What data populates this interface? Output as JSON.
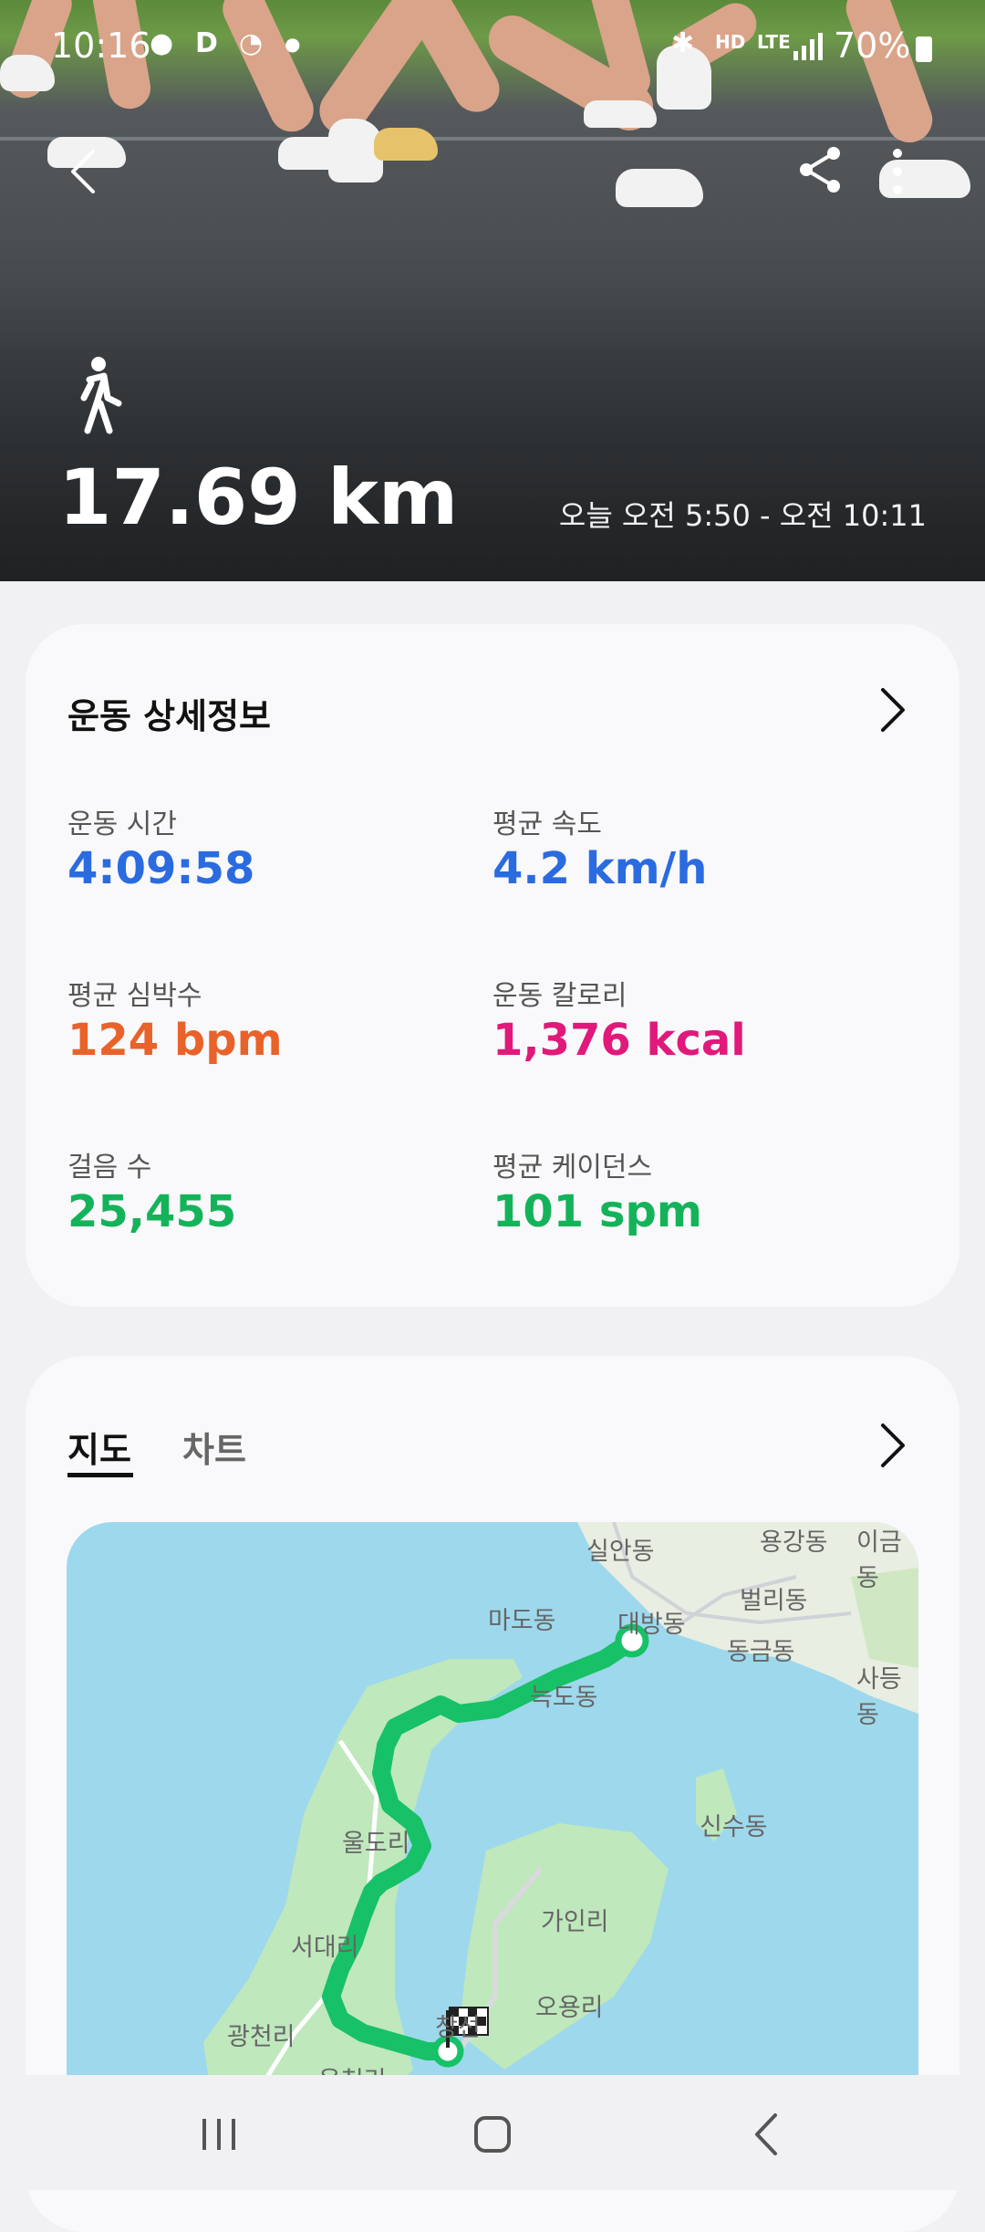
{
  "status_bar": {
    "time": "10:16",
    "left_icons": [
      "chat-icon",
      "d-icon",
      "whowho-icon",
      "dot-icon"
    ],
    "right_icons": [
      "bluetooth-icon",
      "hd-voice-icon",
      "lte-icon",
      "signal-icon",
      "battery-icon"
    ],
    "battery": "70%",
    "hd_label": "HD",
    "lte_label": "LTE"
  },
  "hero": {
    "distance": "17.69 km",
    "time_range": "오늘 오전 5:50 - 오전 10:11",
    "activity_icon": "walking-person-icon"
  },
  "details": {
    "title": "운동 상세정보",
    "metrics": [
      {
        "label": "운동 시간",
        "value": "4:09:58",
        "color": "#2a6be0"
      },
      {
        "label": "평균 속도",
        "value": "4.2 km/h",
        "color": "#2a6be0"
      },
      {
        "label": "평균 심박수",
        "value": "124 bpm",
        "color": "#e8622a"
      },
      {
        "label": "운동 칼로리",
        "value": "1,376 kcal",
        "color": "#e0197a"
      },
      {
        "label": "걸음 수",
        "value": "25,455",
        "color": "#14b35a"
      },
      {
        "label": "평균 케이던스",
        "value": "101 spm",
        "color": "#14b35a"
      }
    ]
  },
  "map_card": {
    "tabs": [
      "지도",
      "차트"
    ],
    "active_tab": "지도",
    "places": [
      "실안동",
      "용강동",
      "이금동",
      "마도동",
      "대방동",
      "벌리동",
      "동금동",
      "사등동",
      "늑도동",
      "울도리",
      "신수동",
      "가인리",
      "서대리",
      "오용리",
      "광천리",
      "옥천리",
      "창선"
    ],
    "route_color": "#17c167"
  },
  "colors": {
    "accent_blue": "#2a6be0",
    "heart_orange": "#e8622a",
    "calorie_pink": "#e0197a",
    "step_green": "#14b35a"
  }
}
